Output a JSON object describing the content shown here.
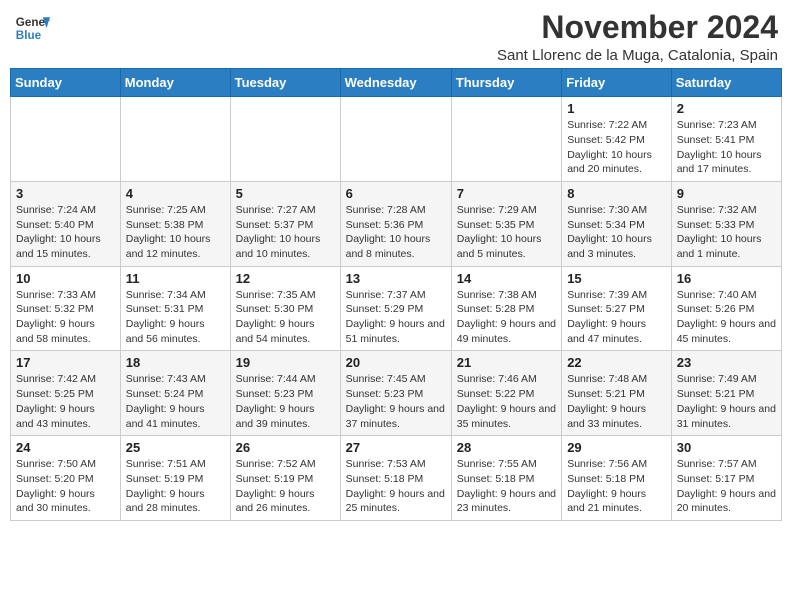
{
  "header": {
    "logo_line1": "General",
    "logo_line2": "Blue",
    "month": "November 2024",
    "location": "Sant Llorenc de la Muga, Catalonia, Spain"
  },
  "weekdays": [
    "Sunday",
    "Monday",
    "Tuesday",
    "Wednesday",
    "Thursday",
    "Friday",
    "Saturday"
  ],
  "weeks": [
    [
      {
        "day": "",
        "info": ""
      },
      {
        "day": "",
        "info": ""
      },
      {
        "day": "",
        "info": ""
      },
      {
        "day": "",
        "info": ""
      },
      {
        "day": "",
        "info": ""
      },
      {
        "day": "1",
        "info": "Sunrise: 7:22 AM\nSunset: 5:42 PM\nDaylight: 10 hours and 20 minutes."
      },
      {
        "day": "2",
        "info": "Sunrise: 7:23 AM\nSunset: 5:41 PM\nDaylight: 10 hours and 17 minutes."
      }
    ],
    [
      {
        "day": "3",
        "info": "Sunrise: 7:24 AM\nSunset: 5:40 PM\nDaylight: 10 hours and 15 minutes."
      },
      {
        "day": "4",
        "info": "Sunrise: 7:25 AM\nSunset: 5:38 PM\nDaylight: 10 hours and 12 minutes."
      },
      {
        "day": "5",
        "info": "Sunrise: 7:27 AM\nSunset: 5:37 PM\nDaylight: 10 hours and 10 minutes."
      },
      {
        "day": "6",
        "info": "Sunrise: 7:28 AM\nSunset: 5:36 PM\nDaylight: 10 hours and 8 minutes."
      },
      {
        "day": "7",
        "info": "Sunrise: 7:29 AM\nSunset: 5:35 PM\nDaylight: 10 hours and 5 minutes."
      },
      {
        "day": "8",
        "info": "Sunrise: 7:30 AM\nSunset: 5:34 PM\nDaylight: 10 hours and 3 minutes."
      },
      {
        "day": "9",
        "info": "Sunrise: 7:32 AM\nSunset: 5:33 PM\nDaylight: 10 hours and 1 minute."
      }
    ],
    [
      {
        "day": "10",
        "info": "Sunrise: 7:33 AM\nSunset: 5:32 PM\nDaylight: 9 hours and 58 minutes."
      },
      {
        "day": "11",
        "info": "Sunrise: 7:34 AM\nSunset: 5:31 PM\nDaylight: 9 hours and 56 minutes."
      },
      {
        "day": "12",
        "info": "Sunrise: 7:35 AM\nSunset: 5:30 PM\nDaylight: 9 hours and 54 minutes."
      },
      {
        "day": "13",
        "info": "Sunrise: 7:37 AM\nSunset: 5:29 PM\nDaylight: 9 hours and 51 minutes."
      },
      {
        "day": "14",
        "info": "Sunrise: 7:38 AM\nSunset: 5:28 PM\nDaylight: 9 hours and 49 minutes."
      },
      {
        "day": "15",
        "info": "Sunrise: 7:39 AM\nSunset: 5:27 PM\nDaylight: 9 hours and 47 minutes."
      },
      {
        "day": "16",
        "info": "Sunrise: 7:40 AM\nSunset: 5:26 PM\nDaylight: 9 hours and 45 minutes."
      }
    ],
    [
      {
        "day": "17",
        "info": "Sunrise: 7:42 AM\nSunset: 5:25 PM\nDaylight: 9 hours and 43 minutes."
      },
      {
        "day": "18",
        "info": "Sunrise: 7:43 AM\nSunset: 5:24 PM\nDaylight: 9 hours and 41 minutes."
      },
      {
        "day": "19",
        "info": "Sunrise: 7:44 AM\nSunset: 5:23 PM\nDaylight: 9 hours and 39 minutes."
      },
      {
        "day": "20",
        "info": "Sunrise: 7:45 AM\nSunset: 5:23 PM\nDaylight: 9 hours and 37 minutes."
      },
      {
        "day": "21",
        "info": "Sunrise: 7:46 AM\nSunset: 5:22 PM\nDaylight: 9 hours and 35 minutes."
      },
      {
        "day": "22",
        "info": "Sunrise: 7:48 AM\nSunset: 5:21 PM\nDaylight: 9 hours and 33 minutes."
      },
      {
        "day": "23",
        "info": "Sunrise: 7:49 AM\nSunset: 5:21 PM\nDaylight: 9 hours and 31 minutes."
      }
    ],
    [
      {
        "day": "24",
        "info": "Sunrise: 7:50 AM\nSunset: 5:20 PM\nDaylight: 9 hours and 30 minutes."
      },
      {
        "day": "25",
        "info": "Sunrise: 7:51 AM\nSunset: 5:19 PM\nDaylight: 9 hours and 28 minutes."
      },
      {
        "day": "26",
        "info": "Sunrise: 7:52 AM\nSunset: 5:19 PM\nDaylight: 9 hours and 26 minutes."
      },
      {
        "day": "27",
        "info": "Sunrise: 7:53 AM\nSunset: 5:18 PM\nDaylight: 9 hours and 25 minutes."
      },
      {
        "day": "28",
        "info": "Sunrise: 7:55 AM\nSunset: 5:18 PM\nDaylight: 9 hours and 23 minutes."
      },
      {
        "day": "29",
        "info": "Sunrise: 7:56 AM\nSunset: 5:18 PM\nDaylight: 9 hours and 21 minutes."
      },
      {
        "day": "30",
        "info": "Sunrise: 7:57 AM\nSunset: 5:17 PM\nDaylight: 9 hours and 20 minutes."
      }
    ]
  ]
}
